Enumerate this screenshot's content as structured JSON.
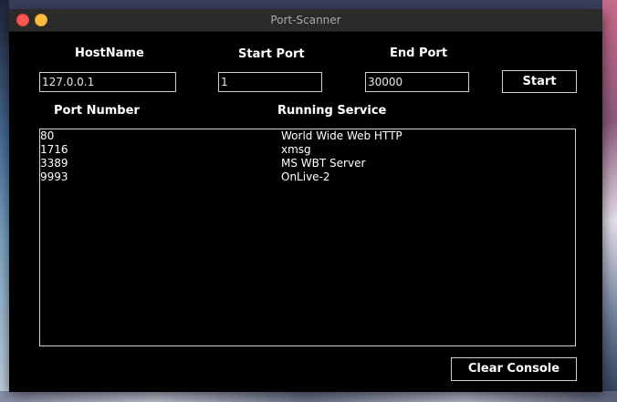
{
  "window": {
    "title": "Port-Scanner"
  },
  "form": {
    "hostname_label": "HostName",
    "hostname_value": "127.0.0.1",
    "start_port_label": "Start Port",
    "start_port_value": "1",
    "end_port_label": "End Port",
    "end_port_value": "30000",
    "start_button": "Start"
  },
  "results": {
    "port_header": "Port Number",
    "service_header": "Running Service",
    "rows": [
      {
        "port": "80",
        "service": "World Wide Web HTTP"
      },
      {
        "port": "1716",
        "service": "xmsg"
      },
      {
        "port": "3389",
        "service": "MS WBT Server"
      },
      {
        "port": "9993",
        "service": "OnLive-2"
      }
    ]
  },
  "footer": {
    "clear_button": "Clear Console"
  },
  "colors": {
    "close": "#fc5753",
    "minimize": "#fdbc40",
    "background": "#000000",
    "foreground": "#ffffff"
  }
}
